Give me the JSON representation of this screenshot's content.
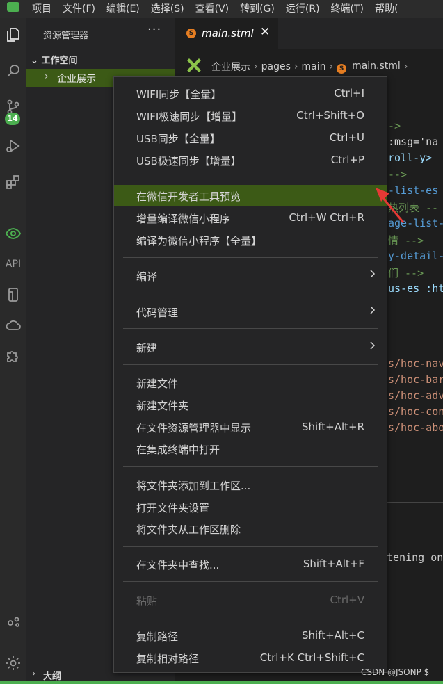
{
  "menubar": {
    "items": [
      "项目",
      "文件(F)",
      "编辑(E)",
      "选择(S)",
      "查看(V)",
      "转到(G)",
      "运行(R)",
      "终端(T)",
      "帮助("
    ]
  },
  "activity": {
    "badge": "14",
    "api_label": "API",
    "icons": [
      "explorer-icon",
      "search-icon",
      "source-control-icon",
      "debug-icon",
      "extensions-icon",
      "preview-eye-icon",
      "api-icon",
      "mobile-icon",
      "cloud-icon",
      "plugin-icon",
      "settings-sync-icon",
      "gear-icon"
    ]
  },
  "sidebar": {
    "title": "资源管理器",
    "more": "···",
    "workspace": "工作空间",
    "folder": "企业展示",
    "outline": "大纲"
  },
  "tab": {
    "icon_letter": "S",
    "name": "main.stml",
    "close": "✕"
  },
  "breadcrumb": {
    "items": [
      "企业展示",
      "pages",
      "main",
      "main.stml"
    ]
  },
  "code": {
    "lines": [
      {
        "text": "->",
        "cls": "c-comment"
      },
      {
        "text": " :msg='na",
        "cls": "c-white"
      },
      {
        "text": "roll-y>",
        "cls": "c-attr"
      },
      {
        "text": " -->",
        "cls": "c-comment"
      },
      {
        "text": "-list-es",
        "cls": "c-tag"
      },
      {
        "text": "热列表 --",
        "cls": "c-comment"
      },
      {
        "text": "age-list-",
        "cls": "c-tag"
      },
      {
        "text": "情 -->",
        "cls": "c-comment"
      },
      {
        "text": "y-detail-",
        "cls": "c-tag"
      },
      {
        "text": "们 -->",
        "cls": "c-comment"
      },
      {
        "text": "us-es :ht",
        "cls": "c-attr"
      },
      {
        "text": "s/hoc-nav",
        "cls": "c-link"
      },
      {
        "text": "s/hoc-bar",
        "cls": "c-link"
      },
      {
        "text": "s/hoc-adv",
        "cls": "c-link"
      },
      {
        "text": "s/hoc-con",
        "cls": "c-link"
      },
      {
        "text": "s/hoc-abo",
        "cls": "c-link"
      }
    ],
    "terminal": "tening on"
  },
  "context_menu": {
    "items": [
      {
        "label": "WIFI同步【全量】",
        "shortcut": "Ctrl+I"
      },
      {
        "label": "WIFI极速同步【增量】",
        "shortcut": "Ctrl+Shift+O"
      },
      {
        "label": "USB同步【全量】",
        "shortcut": "Ctrl+U"
      },
      {
        "label": "USB极速同步【增量】",
        "shortcut": "Ctrl+P"
      },
      {
        "label": "在微信开发者工具预览",
        "shortcut": ""
      },
      {
        "label": "增量编译微信小程序",
        "shortcut": "Ctrl+W Ctrl+R"
      },
      {
        "label": "编译为微信小程序【全量】",
        "shortcut": ""
      },
      {
        "label": "编译",
        "shortcut": ""
      },
      {
        "label": "代码管理",
        "shortcut": ""
      },
      {
        "label": "新建",
        "shortcut": ""
      },
      {
        "label": "新建文件",
        "shortcut": ""
      },
      {
        "label": "新建文件夹",
        "shortcut": ""
      },
      {
        "label": "在文件资源管理器中显示",
        "shortcut": "Shift+Alt+R"
      },
      {
        "label": "在集成终端中打开",
        "shortcut": ""
      },
      {
        "label": "将文件夹添加到工作区...",
        "shortcut": ""
      },
      {
        "label": "打开文件夹设置",
        "shortcut": ""
      },
      {
        "label": "将文件夹从工作区删除",
        "shortcut": ""
      },
      {
        "label": "在文件夹中查找...",
        "shortcut": "Shift+Alt+F"
      },
      {
        "label": "粘贴",
        "shortcut": "Ctrl+V"
      },
      {
        "label": "复制路径",
        "shortcut": "Shift+Alt+C"
      },
      {
        "label": "复制相对路径",
        "shortcut": "Ctrl+K Ctrl+Shift+C"
      }
    ]
  },
  "watermark": "CSDN @JSONP $",
  "colors": {
    "highlight": "#3c5a16",
    "accent_green": "#4caf50",
    "arrow_red": "#e53935",
    "file_icon": "#e67e22"
  }
}
